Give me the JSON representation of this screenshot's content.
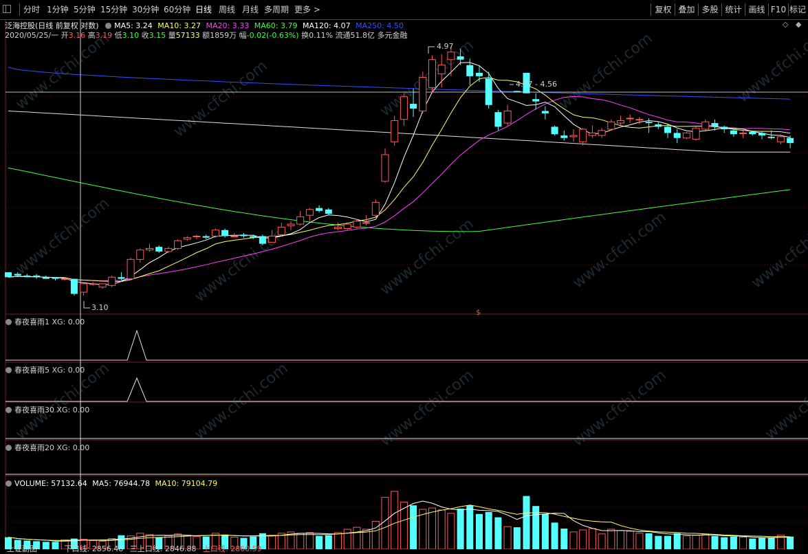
{
  "toolbar": {
    "left_items": [
      "分时",
      "1分钟",
      "5分钟",
      "15分钟",
      "30分钟",
      "60分钟",
      "日线",
      "周线",
      "月线",
      "多周期",
      "更多 >"
    ],
    "right_items": [
      "复权",
      "叠加",
      "多股",
      "统计",
      "画线",
      "F10",
      "标记"
    ]
  },
  "header": {
    "title": "泛海控股(日线 前复权 对数)",
    "ma5": "MA5: 3.24",
    "ma10": "MA10: 3.27",
    "ma20": "MA20: 3.33",
    "ma60": "MA60: 3.79",
    "ma120": "MA120: 4.07",
    "ma250": "MA250: 4.50",
    "date": "2020/05/25/一",
    "open_label": "开",
    "open": "3.16",
    "high_label": "高",
    "high": "3.19",
    "low_label": "低",
    "low": "3.10",
    "close_label": "收",
    "close": "3.15",
    "vol_label": "量",
    "vol": "57133",
    "amt_label": "额",
    "amt": "1859万",
    "chg_label": "幅",
    "chg": "-0.02(-0.63%)",
    "turn_label": "换",
    "turn": "0.11%",
    "float_label": "流通",
    "float_val": "51.8亿",
    "sector": "多元金融"
  },
  "annotations": {
    "high_label": "4.97",
    "low_label": "3.10",
    "range_label": "4.57 - 4.56",
    "dollar_mark": "$"
  },
  "subpanels": [
    {
      "name": "春夜喜雨1",
      "xg": "XG: 0.00"
    },
    {
      "name": "春夜喜雨5",
      "xg": "XG: 0.00"
    },
    {
      "name": "春夜喜雨30",
      "xg": "XG: 0.00"
    },
    {
      "name": "春夜喜雨20",
      "xg": "XG: 0.00"
    }
  ],
  "volume_header": {
    "vol": "VOLUME: 57132.64",
    "ma5": "MA5: 76944.78",
    "ma10": "MA10: 79104.79"
  },
  "footer": {
    "index_name": "上证副图",
    "line1": "下口线: 2856.48",
    "line2": "三上口线: 2846.88",
    "line3": "上口线: 2860.59"
  },
  "watermark": "www.cfchi.com",
  "colors": {
    "up": "#ff5a5a",
    "down": "#54ffff",
    "ma5": "#ffffff",
    "ma10": "#ffff66",
    "ma20": "#ff40ff",
    "ma60": "#40ff40",
    "ma120": "#ffffff",
    "ma250": "#3050ff"
  },
  "chart_data": {
    "type": "candlestick",
    "scale": "log",
    "date": "2020/05/25",
    "visible_high": 4.97,
    "visible_low": 3.1,
    "ohlc": [
      [
        3.24,
        3.24,
        3.21,
        3.21
      ],
      [
        3.23,
        3.24,
        3.21,
        3.22
      ],
      [
        3.22,
        3.23,
        3.21,
        3.21
      ],
      [
        3.22,
        3.23,
        3.2,
        3.21
      ],
      [
        3.21,
        3.22,
        3.2,
        3.2
      ],
      [
        3.21,
        3.21,
        3.19,
        3.2
      ],
      [
        3.2,
        3.21,
        3.19,
        3.2
      ],
      [
        3.2,
        3.2,
        3.1,
        3.11
      ],
      [
        3.12,
        3.18,
        3.1,
        3.17
      ],
      [
        3.17,
        3.18,
        3.16,
        3.17
      ],
      [
        3.15,
        3.17,
        3.14,
        3.17
      ],
      [
        3.16,
        3.22,
        3.15,
        3.21
      ],
      [
        3.21,
        3.24,
        3.19,
        3.2
      ],
      [
        3.2,
        3.33,
        3.19,
        3.32
      ],
      [
        3.32,
        3.39,
        3.3,
        3.38
      ],
      [
        3.38,
        3.42,
        3.37,
        3.39
      ],
      [
        3.4,
        3.41,
        3.36,
        3.37
      ],
      [
        3.37,
        3.4,
        3.36,
        3.39
      ],
      [
        3.39,
        3.45,
        3.38,
        3.44
      ],
      [
        3.45,
        3.47,
        3.44,
        3.46
      ],
      [
        3.47,
        3.48,
        3.45,
        3.47
      ],
      [
        3.47,
        3.48,
        3.45,
        3.46
      ],
      [
        3.47,
        3.52,
        3.46,
        3.51
      ],
      [
        3.51,
        3.52,
        3.46,
        3.47
      ],
      [
        3.47,
        3.49,
        3.46,
        3.47
      ],
      [
        3.48,
        3.49,
        3.46,
        3.47
      ],
      [
        3.47,
        3.48,
        3.45,
        3.46
      ],
      [
        3.47,
        3.48,
        3.41,
        3.42
      ],
      [
        3.43,
        3.51,
        3.43,
        3.47
      ],
      [
        3.48,
        3.56,
        3.47,
        3.53
      ],
      [
        3.54,
        3.57,
        3.51,
        3.55
      ],
      [
        3.55,
        3.64,
        3.54,
        3.6
      ],
      [
        3.61,
        3.66,
        3.57,
        3.65
      ],
      [
        3.66,
        3.68,
        3.63,
        3.64
      ],
      [
        3.65,
        3.66,
        3.61,
        3.62
      ],
      [
        3.52,
        3.56,
        3.51,
        3.53
      ],
      [
        3.52,
        3.56,
        3.51,
        3.55
      ],
      [
        3.53,
        3.58,
        3.52,
        3.57
      ],
      [
        3.56,
        3.61,
        3.54,
        3.56
      ],
      [
        3.61,
        3.72,
        3.6,
        3.7
      ],
      [
        3.85,
        4.1,
        3.84,
        4.05
      ],
      [
        4.15,
        4.36,
        4.12,
        4.32
      ],
      [
        4.33,
        4.55,
        4.28,
        4.52
      ],
      [
        4.46,
        4.59,
        4.35,
        4.42
      ],
      [
        4.4,
        4.74,
        4.38,
        4.69
      ],
      [
        4.6,
        4.89,
        4.55,
        4.85
      ],
      [
        4.72,
        4.9,
        4.6,
        4.8
      ],
      [
        4.85,
        4.97,
        4.7,
        4.92
      ],
      [
        4.88,
        4.95,
        4.8,
        4.85
      ],
      [
        4.8,
        4.86,
        4.62,
        4.7
      ],
      [
        4.73,
        4.8,
        4.65,
        4.7
      ],
      [
        4.68,
        4.74,
        4.42,
        4.45
      ],
      [
        4.39,
        4.41,
        4.24,
        4.27
      ],
      [
        4.3,
        4.45,
        4.28,
        4.4
      ],
      [
        4.57,
        4.57,
        4.56,
        4.56
      ],
      [
        4.73,
        4.73,
        4.55,
        4.55
      ],
      [
        4.5,
        4.55,
        4.41,
        4.48
      ],
      [
        4.4,
        4.44,
        4.33,
        4.38
      ],
      [
        4.27,
        4.28,
        4.2,
        4.21
      ],
      [
        4.2,
        4.24,
        4.16,
        4.18
      ],
      [
        4.19,
        4.25,
        4.15,
        4.2
      ],
      [
        4.15,
        4.26,
        4.12,
        4.25
      ],
      [
        4.2,
        4.28,
        4.18,
        4.22
      ],
      [
        4.2,
        4.26,
        4.18,
        4.24
      ],
      [
        4.25,
        4.33,
        4.24,
        4.31
      ],
      [
        4.3,
        4.36,
        4.28,
        4.32
      ],
      [
        4.34,
        4.37,
        4.3,
        4.34
      ],
      [
        4.33,
        4.35,
        4.29,
        4.33
      ],
      [
        4.31,
        4.34,
        4.22,
        4.3
      ],
      [
        4.29,
        4.31,
        4.25,
        4.27
      ],
      [
        4.27,
        4.29,
        4.18,
        4.22
      ],
      [
        4.22,
        4.25,
        4.14,
        4.18
      ],
      [
        4.18,
        4.23,
        4.17,
        4.22
      ],
      [
        4.17,
        4.27,
        4.16,
        4.26
      ],
      [
        4.25,
        4.33,
        4.24,
        4.31
      ],
      [
        4.3,
        4.33,
        4.24,
        4.27
      ],
      [
        4.27,
        4.28,
        4.22,
        4.25
      ],
      [
        4.24,
        4.25,
        4.19,
        4.21
      ],
      [
        4.22,
        4.24,
        4.18,
        4.22
      ],
      [
        4.23,
        4.24,
        4.2,
        4.21
      ],
      [
        4.22,
        4.23,
        4.17,
        4.2
      ],
      [
        4.19,
        4.24,
        4.17,
        4.18
      ],
      [
        4.15,
        4.21,
        4.13,
        4.19
      ],
      [
        4.18,
        4.2,
        4.1,
        4.14
      ]
    ],
    "volume": [
      18,
      14,
      13,
      12,
      11,
      11,
      14,
      16,
      15,
      13,
      12,
      16,
      21,
      20,
      24,
      22,
      18,
      20,
      23,
      21,
      19,
      19,
      24,
      22,
      18,
      17,
      19,
      24,
      21,
      24,
      26,
      24,
      25,
      20,
      21,
      25,
      30,
      33,
      30,
      42,
      78,
      87,
      71,
      66,
      60,
      62,
      59,
      54,
      61,
      66,
      53,
      56,
      48,
      34,
      33,
      80,
      65,
      53,
      40,
      31,
      26,
      29,
      31,
      23,
      30,
      28,
      27,
      24,
      24,
      20,
      20,
      24,
      20,
      21,
      22,
      20,
      18,
      19,
      18,
      16,
      17,
      17,
      21,
      19
    ]
  }
}
